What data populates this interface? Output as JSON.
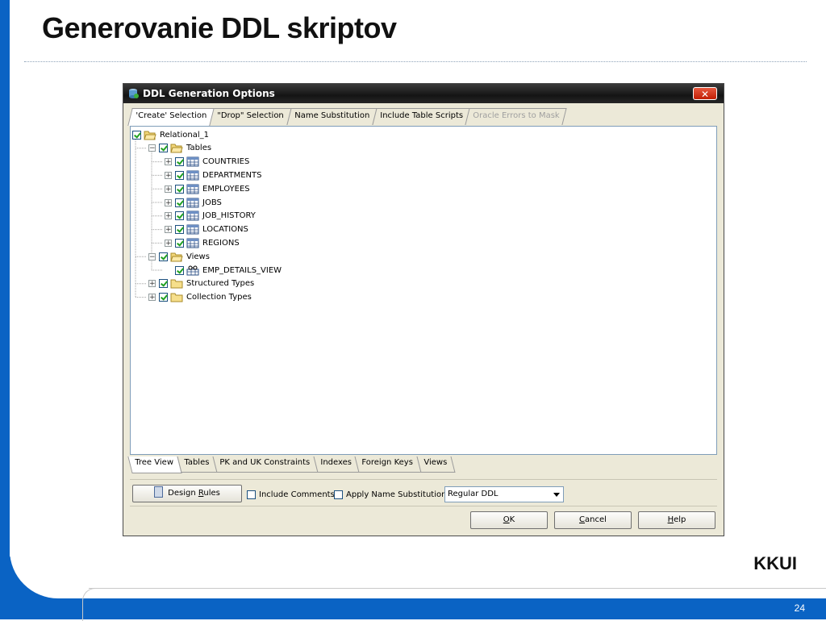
{
  "slide": {
    "title": "Generovanie DDL skriptov",
    "footer_label": "KKUI",
    "page_number": "24"
  },
  "dialog": {
    "title": "DDL Generation Options",
    "close_label": "✕",
    "top_tabs": [
      {
        "label": "'Create' Selection",
        "active": true,
        "enabled": true
      },
      {
        "label": "\"Drop\" Selection",
        "active": false,
        "enabled": true
      },
      {
        "label": "Name Substitution",
        "active": false,
        "enabled": true
      },
      {
        "label": "Include Table Scripts",
        "active": false,
        "enabled": true
      },
      {
        "label": "Oracle Errors to Mask",
        "active": false,
        "enabled": false
      }
    ],
    "tree": [
      {
        "label": "Relational_1",
        "icon": "folder-open-icon",
        "checked": true,
        "expander": "none"
      },
      {
        "label": "Tables",
        "icon": "folder-open-icon",
        "checked": true,
        "expander": "minus"
      },
      {
        "label": "COUNTRIES",
        "icon": "table-icon",
        "checked": true,
        "expander": "plus"
      },
      {
        "label": "DEPARTMENTS",
        "icon": "table-icon",
        "checked": true,
        "expander": "plus"
      },
      {
        "label": "EMPLOYEES",
        "icon": "table-icon",
        "checked": true,
        "expander": "plus"
      },
      {
        "label": "JOBS",
        "icon": "table-icon",
        "checked": true,
        "expander": "plus"
      },
      {
        "label": "JOB_HISTORY",
        "icon": "table-icon",
        "checked": true,
        "expander": "plus"
      },
      {
        "label": "LOCATIONS",
        "icon": "table-icon",
        "checked": true,
        "expander": "plus"
      },
      {
        "label": "REGIONS",
        "icon": "table-icon",
        "checked": true,
        "expander": "plus"
      },
      {
        "label": "Views",
        "icon": "folder-open-icon",
        "checked": true,
        "expander": "minus"
      },
      {
        "label": "EMP_DETAILS_VIEW",
        "icon": "view-icon",
        "checked": true,
        "expander": "none"
      },
      {
        "label": "Structured Types",
        "icon": "folder-icon",
        "checked": true,
        "expander": "plus"
      },
      {
        "label": "Collection Types",
        "icon": "folder-icon",
        "checked": true,
        "expander": "plus"
      }
    ],
    "bottom_tabs": [
      {
        "label": "Tree View",
        "active": true
      },
      {
        "label": "Tables",
        "active": false
      },
      {
        "label": "PK and UK Constraints",
        "active": false
      },
      {
        "label": "Indexes",
        "active": false
      },
      {
        "label": "Foreign Keys",
        "active": false
      },
      {
        "label": "Views",
        "active": false
      }
    ],
    "options": {
      "design_rules_pre": "Design ",
      "design_rules_mnemonic": "R",
      "design_rules_post": "ules",
      "include_comments_label": "Include Comments",
      "include_comments_checked": false,
      "apply_name_substitution_label": "Apply Name Substitution",
      "apply_name_substitution_checked": false,
      "ddl_type_selected": "Regular DDL"
    },
    "buttons": {
      "ok_mnemonic": "O",
      "ok_rest": "K",
      "cancel_mnemonic": "C",
      "cancel_rest": "ancel",
      "help_mnemonic": "H",
      "help_rest": "elp"
    }
  },
  "colors": {
    "slide_blue": "#0a63c4",
    "dialog_face": "#ece9d8",
    "check_green": "#21a121"
  }
}
